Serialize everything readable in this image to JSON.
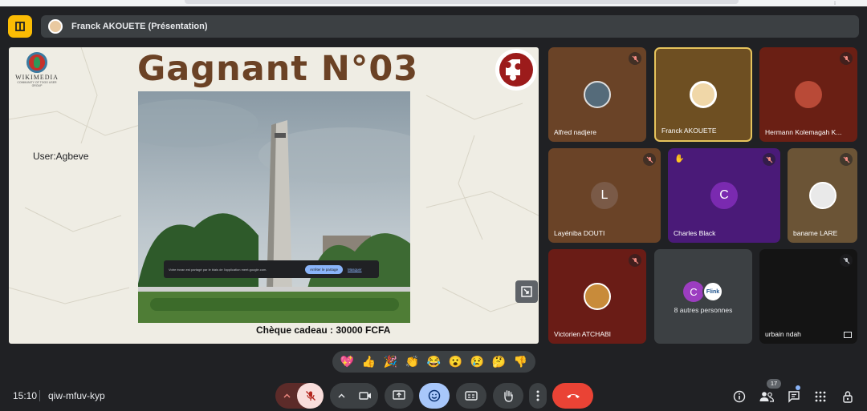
{
  "header": {
    "presenter_label": "Franck AKOUETE (Présentation)"
  },
  "slide": {
    "logo_title": "WIKIMEDIA",
    "logo_subtitle": "COMMUNITY OF TOGO USER GROUP",
    "title": "Gagnant N°03",
    "user_label": "User:Agbeve",
    "prize": "Chèque cadeau : 30000 FCFA",
    "share_notice": "Votre écran est partagé par le biais de l'application meet.google.com.",
    "share_stop_button": "Arrêter le partage",
    "share_hide": "Masquer"
  },
  "participants": [
    {
      "name": "Alfred nadjere",
      "bg": "#6a4327",
      "muted": true
    },
    {
      "name": "Franck AKOUETE",
      "bg": "#6e4f22",
      "muted": false,
      "active": true
    },
    {
      "name": "Hermann Kolemagah K...",
      "bg": "#6a1f14",
      "muted": true
    },
    {
      "name": "Layéniba DOUTI",
      "letter": "L",
      "bg": "#6a4327",
      "letter_bg": "#7a5a47",
      "muted": true
    },
    {
      "name": "Charles Black",
      "letter": "C",
      "bg": "#4a1a78",
      "letter_bg": "#7a2ab0",
      "muted": true,
      "hand": true
    },
    {
      "name": "baname LARE",
      "bg": "#6b5436",
      "muted": true
    },
    {
      "name": "Victorien ATCHABI",
      "bg": "#6a1c16",
      "muted": true
    },
    {
      "name": "8 autres personnes",
      "bg": "#3c4043",
      "letter": "C"
    },
    {
      "name": "urbain ndah",
      "bg": "#141414",
      "muted": true
    }
  ],
  "others_avatar_text": "Flink",
  "reactions": [
    "💖",
    "👍",
    "🎉",
    "👏",
    "😂",
    "😮",
    "😢",
    "🤔",
    "👎"
  ],
  "footer": {
    "time": "15:10",
    "meeting_code": "qiw-mfuv-kyp",
    "participants_count": "17"
  },
  "colors": {
    "accent_blue": "#8ab4f8",
    "end_call": "#ea4335",
    "pin_yellow": "#fbbc04",
    "mic_muted_bg": "#f9dedc"
  },
  "icons": [
    "pin-icon",
    "mic-off-icon",
    "camera-icon",
    "present-icon",
    "emoji-icon",
    "captions-icon",
    "raise-hand-icon",
    "more-icon",
    "end-call-icon",
    "info-icon",
    "people-icon",
    "chat-icon",
    "apps-icon",
    "lock-icon"
  ]
}
